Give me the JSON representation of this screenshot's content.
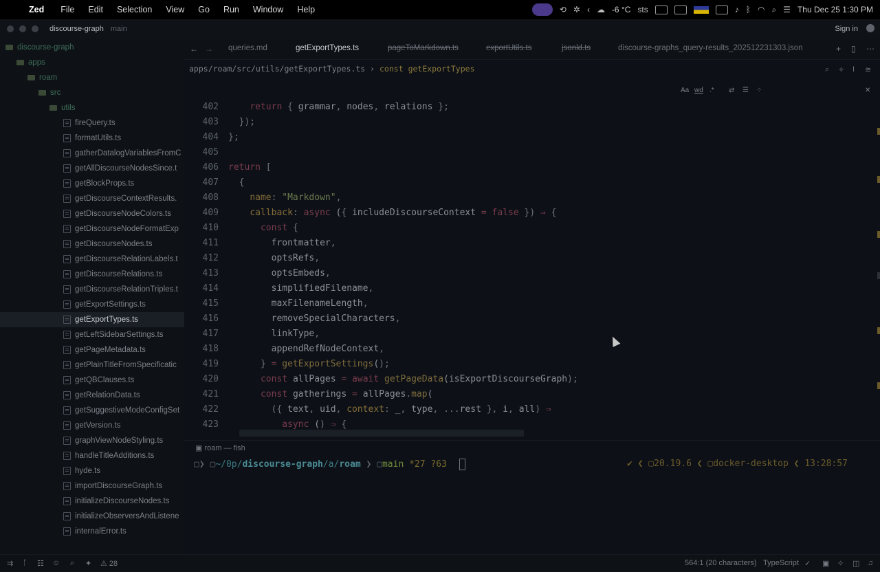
{
  "menubar": {
    "app": "Zed",
    "items": [
      "File",
      "Edit",
      "Selection",
      "View",
      "Go",
      "Run",
      "Window",
      "Help"
    ],
    "weather": "-6 °C",
    "status_extra": "sts",
    "datetime": "Thu Dec 25  1:30 PM"
  },
  "window": {
    "project": "discourse-graph",
    "branch": "main",
    "signin": "Sign in"
  },
  "sidebar": {
    "root": "discourse-graph",
    "folders": [
      "apps",
      "roam",
      "src",
      "utils"
    ],
    "files": [
      "fireQuery.ts",
      "formatUtils.ts",
      "gatherDatalogVariablesFromC",
      "getAllDiscourseNodesSince.t",
      "getBlockProps.ts",
      "getDiscourseContextResults.",
      "getDiscourseNodeColors.ts",
      "getDiscourseNodeFormatExp",
      "getDiscourseNodes.ts",
      "getDiscourseRelationLabels.t",
      "getDiscourseRelations.ts",
      "getDiscourseRelationTriples.t",
      "getExportSettings.ts",
      "getExportTypes.ts",
      "getLeftSidebarSettings.ts",
      "getPageMetadata.ts",
      "getPlainTitleFromSpecificatic",
      "getQBClauses.ts",
      "getRelationData.ts",
      "getSuggestiveModeConfigSet",
      "getVersion.ts",
      "graphViewNodeStyling.ts",
      "handleTitleAdditions.ts",
      "hyde.ts",
      "importDiscourseGraph.ts",
      "initializeDiscourseNodes.ts",
      "initializeObserversAndListene",
      "internalError.ts"
    ],
    "selected_file": "getExportTypes.ts"
  },
  "tabs": [
    {
      "label": "queries.md"
    },
    {
      "label": "getExportTypes.ts"
    },
    {
      "label": "pageToMarkdown.ts"
    },
    {
      "label": "exportUtils.ts"
    },
    {
      "label": "jsonld.ts"
    },
    {
      "label": "discourse-graphs_query-results_202512231303.json"
    }
  ],
  "breadcrumb": {
    "path": "apps/roam/src/utils/getExportTypes.ts",
    "sep": "›",
    "keyword": "const",
    "symbol": "getExportTypes"
  },
  "search_toolbar": {
    "case": "Aa",
    "word": "wd",
    "regex": ".*"
  },
  "editor": {
    "lines": [
      {
        "n": "402",
        "text": "    return { grammar, nodes, relations };"
      },
      {
        "n": "403",
        "text": "  });"
      },
      {
        "n": "404",
        "text": "};"
      },
      {
        "n": "405",
        "text": ""
      },
      {
        "n": "406",
        "text": "return ["
      },
      {
        "n": "407",
        "text": "  {"
      },
      {
        "n": "408",
        "text": "    name: \"Markdown\","
      },
      {
        "n": "409",
        "text": "    callback: async ({ includeDiscourseContext = false }) ⇒ {"
      },
      {
        "n": "410",
        "text": "      const {"
      },
      {
        "n": "411",
        "text": "        frontmatter,"
      },
      {
        "n": "412",
        "text": "        optsRefs,"
      },
      {
        "n": "413",
        "text": "        optsEmbeds,"
      },
      {
        "n": "414",
        "text": "        simplifiedFilename,"
      },
      {
        "n": "415",
        "text": "        maxFilenameLength,"
      },
      {
        "n": "416",
        "text": "        removeSpecialCharacters,"
      },
      {
        "n": "417",
        "text": "        linkType,"
      },
      {
        "n": "418",
        "text": "        appendRefNodeContext,"
      },
      {
        "n": "419",
        "text": "      } = getExportSettings();"
      },
      {
        "n": "420",
        "text": "      const allPages = await getPageData(isExportDiscourseGraph);"
      },
      {
        "n": "421",
        "text": "      const gatherings = allPages.map("
      },
      {
        "n": "422",
        "text": "        ({ text, uid, context: _, type, ...rest }, i, all) ⇒"
      },
      {
        "n": "423",
        "text": "          async () ⇒ {"
      }
    ]
  },
  "terminal": {
    "tab": "roam — fish",
    "prompt_dir_prefix": "~/0p/",
    "prompt_dir_bold": "discourse-graph",
    "prompt_dir_suffix": "/a/",
    "prompt_dir_end": "roam",
    "branch": "main",
    "stats": "*27 ?63",
    "node_version": "20.19.6",
    "context": "docker-desktop",
    "time": "13:28:57"
  },
  "statusbar": {
    "warnings": "28",
    "cursor": "564:1 (20 characters)",
    "language": "TypeScript"
  }
}
